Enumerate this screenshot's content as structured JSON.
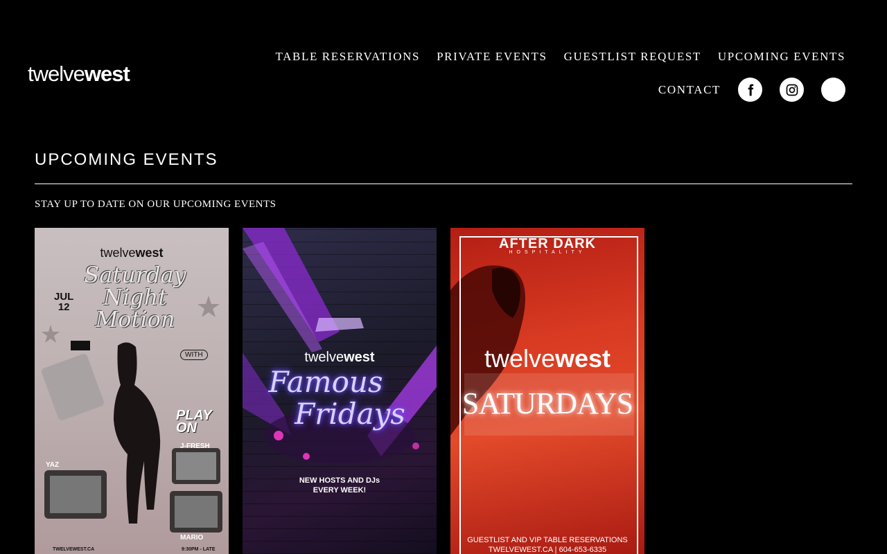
{
  "logo": {
    "part1": "twelve",
    "part2": "west"
  },
  "nav": {
    "table_reservations": "TABLE RESERVATIONS",
    "private_events": "PRIVATE EVENTS",
    "guestlist_request": "GUESTLIST REQUEST",
    "upcoming_events": "UPCOMING EVENTS",
    "contact": "CONTACT"
  },
  "social": [
    {
      "name": "facebook-icon"
    },
    {
      "name": "instagram-icon"
    },
    {
      "name": "blank-social-icon"
    }
  ],
  "page": {
    "title": "UPCOMING EVENTS",
    "subtitle": "STAY UP TO DATE ON OUR UPCOMING EVENTS"
  },
  "posters": [
    {
      "brand_a": "twelve",
      "brand_b": "west",
      "date_month": "JUL",
      "date_day": "12",
      "title_1": "Saturday",
      "title_2": "Night",
      "title_3": "Motion",
      "with": "WITH",
      "play_on": "PLAY ON",
      "dj_1": "J-FRESH",
      "dj_2": "YAZ",
      "dj_3": "MARIO",
      "website": "TWELVEWEST.CA",
      "time": "9:30PM - LATE"
    },
    {
      "brand_a": "twelve",
      "brand_b": "west",
      "title_1": "Famous",
      "title_2": "Fridays",
      "tag_1": "NEW HOSTS AND DJs",
      "tag_2": "EVERY WEEK!"
    },
    {
      "header": "AFTER DARK",
      "header_sub": "HOSPITALITY",
      "brand_a": "twelve",
      "brand_b": "west",
      "title": "SATURDAYS",
      "footer_1": "GUESTLIST AND VIP TABLE RESERVATIONS",
      "footer_2": "TWELVEWEST.CA | 604-653-6335"
    }
  ],
  "colors": {
    "background": "#000000",
    "text": "#ffffff"
  }
}
